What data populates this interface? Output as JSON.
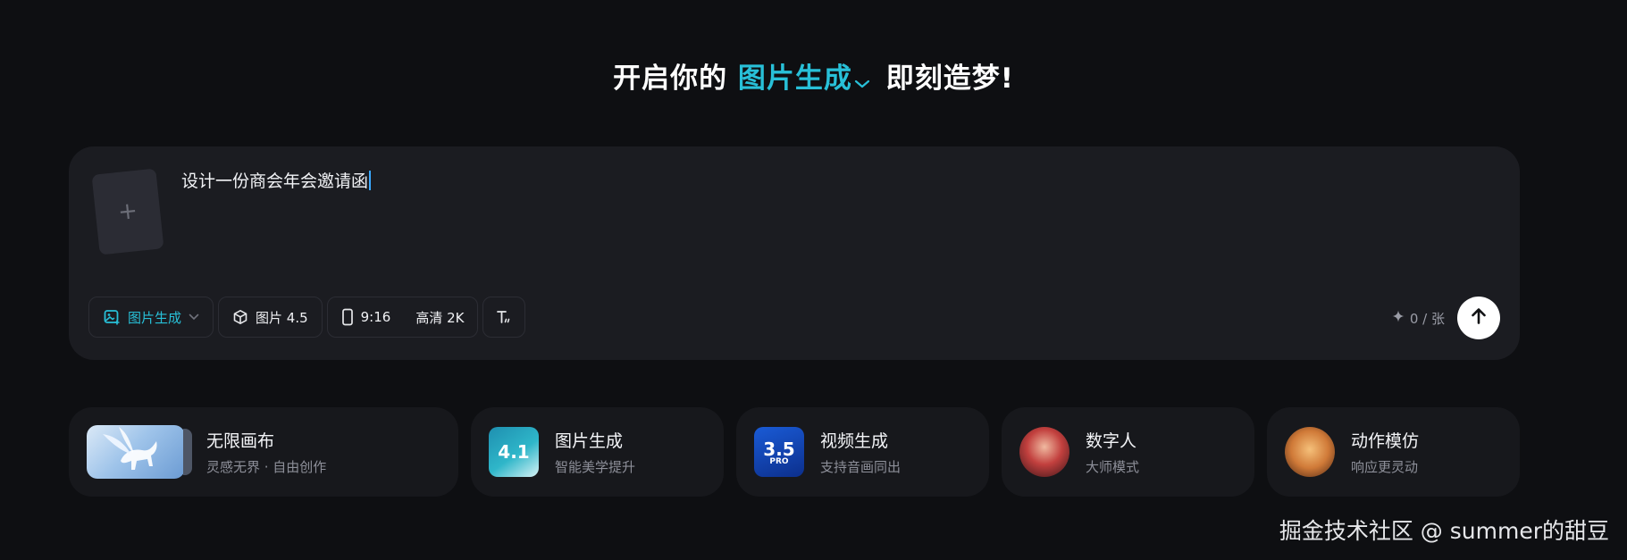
{
  "headline": {
    "prefix": "开启你的",
    "mode": "图片生成",
    "suffix": "即刻造梦!"
  },
  "composer": {
    "upload_plus": "+",
    "prompt_value": "设计一份商会年会邀请函",
    "toolbar": {
      "mode_label": "图片生成",
      "model_label": "图片 4.5",
      "ratio_label": "9:16",
      "quality_label": "高清 2K",
      "text_style_icon": "text-style-icon"
    },
    "credits": {
      "icon": "sparkle-icon",
      "label": "0 / 张"
    },
    "send_icon": "arrow-up-icon"
  },
  "features": [
    {
      "title": "无限画布",
      "subtitle": "灵感无界 · 自由创作",
      "thumb": "pegasus-canvas"
    },
    {
      "title": "图片生成",
      "subtitle": "智能美学提升",
      "thumb_text": "4.1"
    },
    {
      "title": "视频生成",
      "subtitle": "支持音画同出",
      "thumb_text": "3.5",
      "thumb_badge": "PRO"
    },
    {
      "title": "数字人",
      "subtitle": "大师模式",
      "thumb": "avatar-portrait"
    },
    {
      "title": "动作模仿",
      "subtitle": "响应更灵动",
      "thumb": "motion-portrait"
    }
  ],
  "watermark": "掘金技术社区 @ summer的甜豆",
  "colors": {
    "accent": "#28c0d8",
    "background": "#0e0f12",
    "card": "#1b1c21"
  }
}
